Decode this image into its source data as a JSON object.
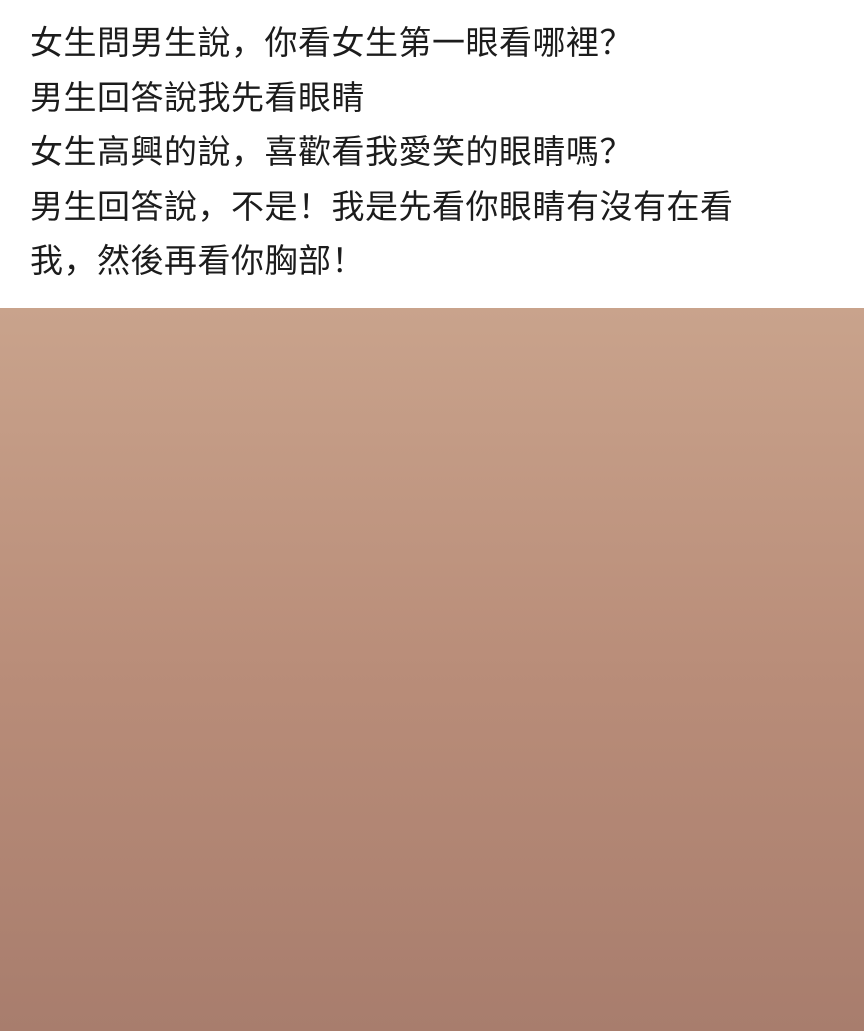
{
  "caption": {
    "lines": [
      "女生問男生說，你看女生第一眼看哪裡？",
      "男生回答說我先看眼睛",
      "女生高興的說，喜歡看我愛笑的眼睛嗎？",
      "男生回答說，不是！我是先看你眼睛有沒有在看",
      "我，然後再看你胸部！"
    ]
  }
}
